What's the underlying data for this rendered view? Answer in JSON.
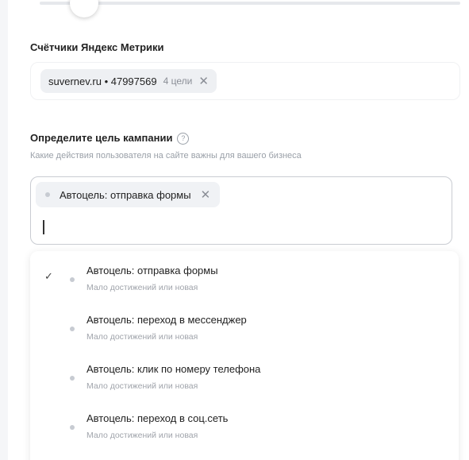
{
  "metrika": {
    "title": "Счётчики Яндекс Метрики",
    "counter": {
      "name": "suvernev.ru • 47997569",
      "goals": "4 цели",
      "remove": "✕"
    }
  },
  "goal": {
    "title": "Определите цель кампании",
    "help": "?",
    "subtitle": "Какие действия пользователя на сайте важны для вашего бизнеса",
    "selected_chip": "Автоцель: отправка формы",
    "remove": "✕",
    "input_value": ""
  },
  "options": [
    {
      "label": "Автоцель: отправка формы",
      "sub": "Мало достижений или новая",
      "checked": true,
      "check": "✓"
    },
    {
      "label": "Автоцель: переход в мессенджер",
      "sub": "Мало достижений или новая",
      "checked": false,
      "check": ""
    },
    {
      "label": "Автоцель: клик по номеру телефона",
      "sub": "Мало достижений или новая",
      "checked": false,
      "check": ""
    },
    {
      "label": "Автоцель: переход в соц.сеть",
      "sub": "Мало достижений или новая",
      "checked": false,
      "check": ""
    }
  ]
}
